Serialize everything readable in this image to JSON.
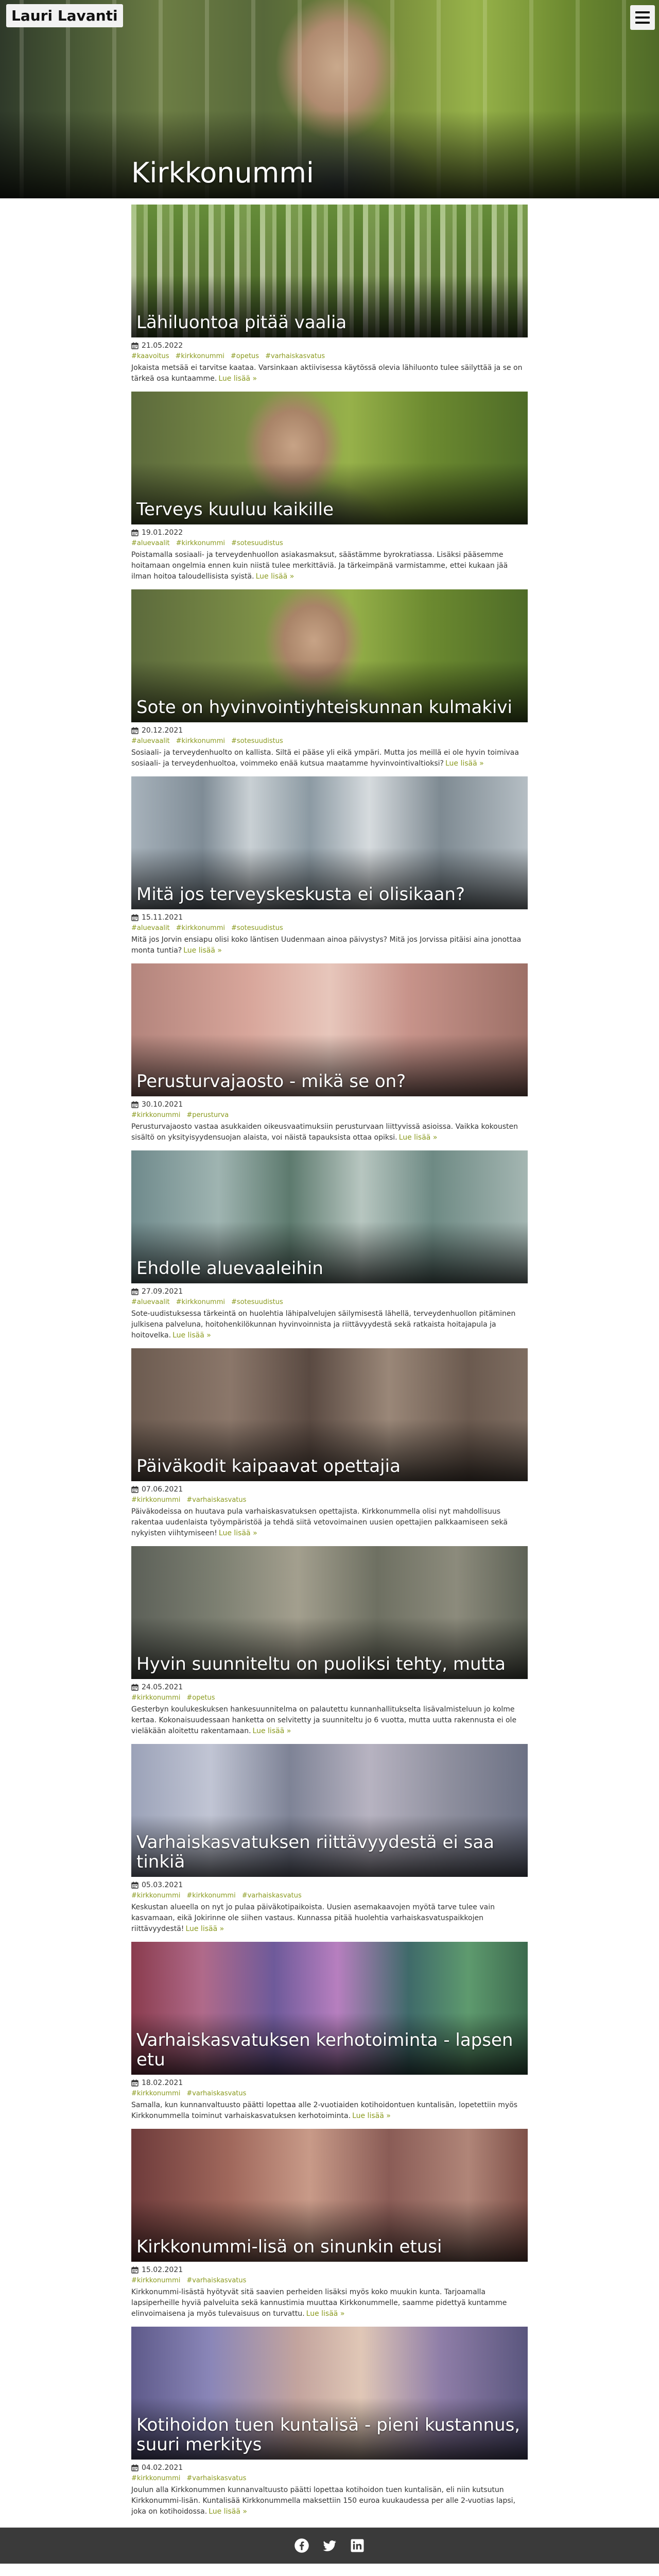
{
  "site": {
    "brand": "Lauri Lavanti",
    "hero_title": "Kirkkonummi"
  },
  "ui": {
    "read_more": "Lue lisää »"
  },
  "posts": [
    {
      "title": "Lähiluontoa pitää vaalia",
      "date": "21.05.2022",
      "tags": [
        "#kaavoitus",
        "#kirkkonummi",
        "#opetus",
        "#varhaiskasvatus"
      ],
      "excerpt": "Jokaista metsää ei tarvitse kaataa. Varsinkaan aktiivisessa käytössä olevia lähiluonto tulee säilyttää ja se on tärkeä osa kuntaamme."
    },
    {
      "title": "Terveys kuuluu kaikille",
      "date": "19.01.2022",
      "tags": [
        "#aluevaalit",
        "#kirkkonummi",
        "#sotesuudistus"
      ],
      "excerpt": "Poistamalla sosiaali- ja terveydenhuollon asiakasmaksut, säästämme byrokratiassa. Lisäksi pääsemme hoitamaan ongelmia ennen kuin niistä tulee merkittäviä. Ja tärkeimpänä varmistamme, ettei kukaan jää ilman hoitoa taloudellisista syistä."
    },
    {
      "title": "Sote on hyvinvointiyhteiskunnan kulmakivi",
      "date": "20.12.2021",
      "tags": [
        "#aluevaalit",
        "#kirkkonummi",
        "#sotesuudistus"
      ],
      "excerpt": "Sosiaali- ja terveydenhuolto on kallista. Siltä ei pääse yli eikä ympäri. Mutta jos meillä ei ole hyvin toimivaa sosiaali- ja terveydenhuoltoa, voimmeko enää kutsua maatamme hyvinvointivaltioksi?"
    },
    {
      "title": "Mitä jos terveyskeskusta ei olisikaan?",
      "date": "15.11.2021",
      "tags": [
        "#aluevaalit",
        "#kirkkonummi",
        "#sotesuudistus"
      ],
      "excerpt": "Mitä jos Jorvin ensiapu olisi koko läntisen Uudenmaan ainoa päivystys? Mitä jos Jorvissa pitäisi aina jonottaa monta tuntia?"
    },
    {
      "title": "Perusturvajaosto - mikä se on?",
      "date": "30.10.2021",
      "tags": [
        "#kirkkonummi",
        "#perusturva"
      ],
      "excerpt": "Perusturvajaosto vastaa asukkaiden oikeusvaatimuksiin perusturvaan liittyvissä asioissa. Vaikka kokousten sisältö on yksityisyydensuojan alaista, voi näistä tapauksista ottaa opiksi."
    },
    {
      "title": "Ehdolle aluevaaleihin",
      "date": "27.09.2021",
      "tags": [
        "#aluevaalit",
        "#kirkkonummi",
        "#sotesuudistus"
      ],
      "excerpt": "Sote-uudistuksessa tärkeintä on huolehtia lähipalvelujen säilymisestä lähellä, terveydenhuollon pitäminen julkisena palveluna, hoitohenkilökunnan hyvinvoinnista ja riittävyydestä sekä ratkaista hoitajapula ja hoitovelka."
    },
    {
      "title": "Päiväkodit kaipaavat opettajia",
      "date": "07.06.2021",
      "tags": [
        "#kirkkonummi",
        "#varhaiskasvatus"
      ],
      "excerpt": "Päiväkodeissa on huutava pula varhaiskasvatuksen opettajista. Kirkkonummella olisi nyt mahdollisuus rakentaa uudenlaista työympäristöä ja tehdä siitä vetovoimainen uusien opettajien palkkaamiseen sekä nykyisten viihtymiseen!"
    },
    {
      "title": "Hyvin suunniteltu on puoliksi tehty, mutta",
      "date": "24.05.2021",
      "tags": [
        "#kirkkonummi",
        "#opetus"
      ],
      "excerpt": "Gesterbyn koulukeskuksen hankesuunnitelma on palautettu kunnanhallitukselta lisävalmisteluun jo kolme kertaa. Kokonaisuudessaan hanketta on selvitetty ja suunniteltu jo 6 vuotta, mutta uutta rakennusta ei ole vieläkään aloitettu rakentamaan."
    },
    {
      "title": "Varhaiskasvatuksen riittävyydestä ei saa tinkiä",
      "date": "05.03.2021",
      "tags": [
        "#kirkkonummi",
        "#kirkkonummi",
        "#varhaiskasvatus"
      ],
      "excerpt": "Keskustan alueella on nyt jo pulaa päiväkotipaikoista. Uusien asemakaavojen myötä tarve tulee vain kasvamaan, eikä Jokirinne ole siihen vastaus. Kunnassa pitää huolehtia varhaiskasvatuspaikkojen riittävyydestä!"
    },
    {
      "title": "Varhaiskasvatuksen kerhotoiminta - lapsen etu",
      "date": "18.02.2021",
      "tags": [
        "#kirkkonummi",
        "#varhaiskasvatus"
      ],
      "excerpt": "Samalla, kun kunnanvaltuusto päätti lopettaa alle 2-vuotiaiden kotihoidontuen kuntalisän, lopetettiin myös Kirkkonummella toiminut varhaiskasvatuksen kerhotoiminta."
    },
    {
      "title": "Kirkkonummi-lisä on sinunkin etusi",
      "date": "15.02.2021",
      "tags": [
        "#kirkkonummi",
        "#varhaiskasvatus"
      ],
      "excerpt": "Kirkkonummi-lisästä hyötyvät sitä saavien perheiden lisäksi myös koko muukin kunta. Tarjoamalla lapsiperheille hyviä palveluita sekä kannustimia muuttaa Kirkkonummelle, saamme pidettyä kuntamme elinvoimaisena ja myös tulevaisuus on turvattu."
    },
    {
      "title": "Kotihoidon tuen kuntalisä - pieni kustannus, suuri merkitys",
      "date": "04.02.2021",
      "tags": [
        "#kirkkonummi",
        "#varhaiskasvatus"
      ],
      "excerpt": "Joulun alla Kirkkonummen kunnanvaltuusto päätti lopettaa kotihoidon tuen kuntalisän, eli niin kutsutun Kirkkonummi-lisän. Kuntalisää Kirkkonummella maksettiin 150 euroa kuukaudessa per alle 2-vuotias lapsi, joka on kotihoidossa."
    }
  ],
  "footer": {
    "icons": [
      "facebook-icon",
      "twitter-icon",
      "linkedin-icon"
    ]
  }
}
